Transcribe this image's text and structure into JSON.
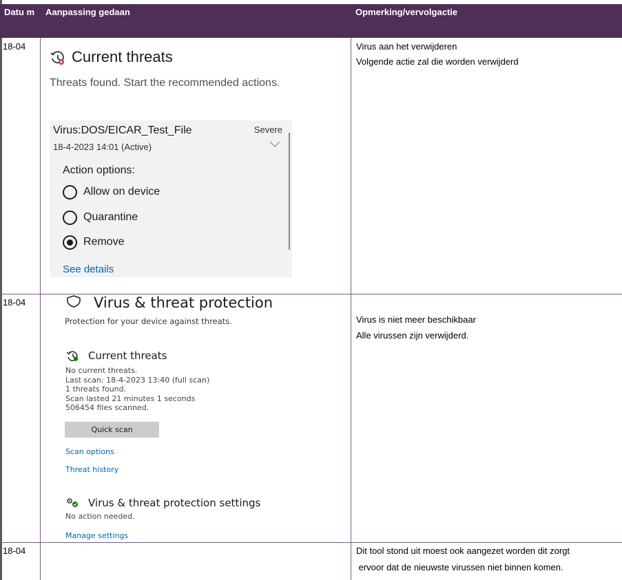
{
  "table": {
    "headers": [
      "Datu m",
      "Aanpassing gedaan",
      "Opmerking/vervolgactie"
    ],
    "rows": [
      {
        "date": "18-04",
        "remark_lines": [
          "Virus aan het verwijderen",
          "Volgende actie zal die worden verwijderd"
        ]
      },
      {
        "date": "18-04",
        "remark_lines": [
          "Virus is niet meer beschikbaar",
          "Alle virussen zijn verwijderd."
        ]
      },
      {
        "date": "18-04",
        "remark_lines": [
          "Dit tool stond uit moest ook aangezet worden dit zorgt",
          " ervoor dat de nieuwste virussen niet binnen komen."
        ]
      }
    ]
  },
  "shot1": {
    "title": "Current threats",
    "subtitle": "Threats found. Start the recommended actions.",
    "threat_name": "Virus:DOS/EICAR_Test_File",
    "threat_date": "18-4-2023 14:01 (Active)",
    "severity": "Severe",
    "action_label": "Action options:",
    "options": [
      {
        "label": "Allow on device",
        "selected": false
      },
      {
        "label": "Quarantine",
        "selected": false
      },
      {
        "label": "Remove",
        "selected": true
      }
    ],
    "details_link": "See details"
  },
  "shot2": {
    "title": "Virus & threat protection",
    "subtitle": "Protection for your device against threats.",
    "threats_heading": "Current threats",
    "status_lines": [
      "No current threats.",
      "Last scan: 18-4-2023 13:40 (full scan)",
      "1 threats found.",
      "Scan lasted 21 minutes 1 seconds",
      "506454 files scanned."
    ],
    "scan_button": "Quick scan",
    "scan_options_link": "Scan options",
    "history_link": "Threat history",
    "settings_heading": "Virus & threat protection settings",
    "settings_status": "No action needed.",
    "manage_link": "Manage settings"
  },
  "colors": {
    "header_bg": "#4e2f57",
    "link": "#0067b8",
    "panel_bg": "#f2f2f2"
  }
}
